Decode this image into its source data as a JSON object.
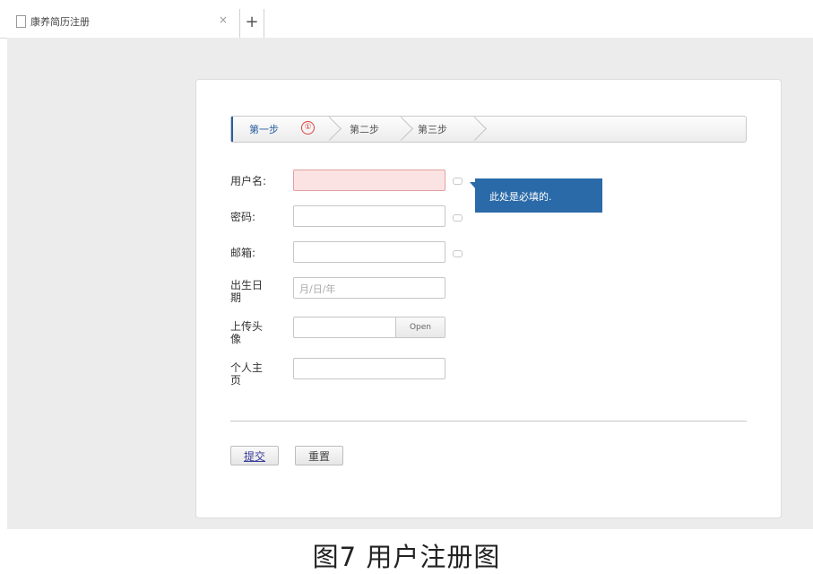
{
  "tab": {
    "title": "康养简历注册",
    "close": "×",
    "new_tab": "+"
  },
  "steps": [
    {
      "label": "第一步",
      "active": true,
      "badge": "①"
    },
    {
      "label": "第二步",
      "active": false
    },
    {
      "label": "第三步",
      "active": false
    }
  ],
  "form": {
    "username_label": "用户名:",
    "password_label": "密码:",
    "email_label": "邮箱:",
    "birthdate_label": "出生日期",
    "birthdate_placeholder": "月/日/年",
    "avatar_label": "上传头像",
    "avatar_button": "Open",
    "homepage_label": "个人主页",
    "tooltip": "此处是必填的."
  },
  "actions": {
    "submit": "提交",
    "reset": "重置"
  },
  "caption": "图7  用户注册图",
  "colors": {
    "accent": "#2a6aa8",
    "error_bg": "#fbe3e3",
    "step_badge": "#d9413b"
  }
}
